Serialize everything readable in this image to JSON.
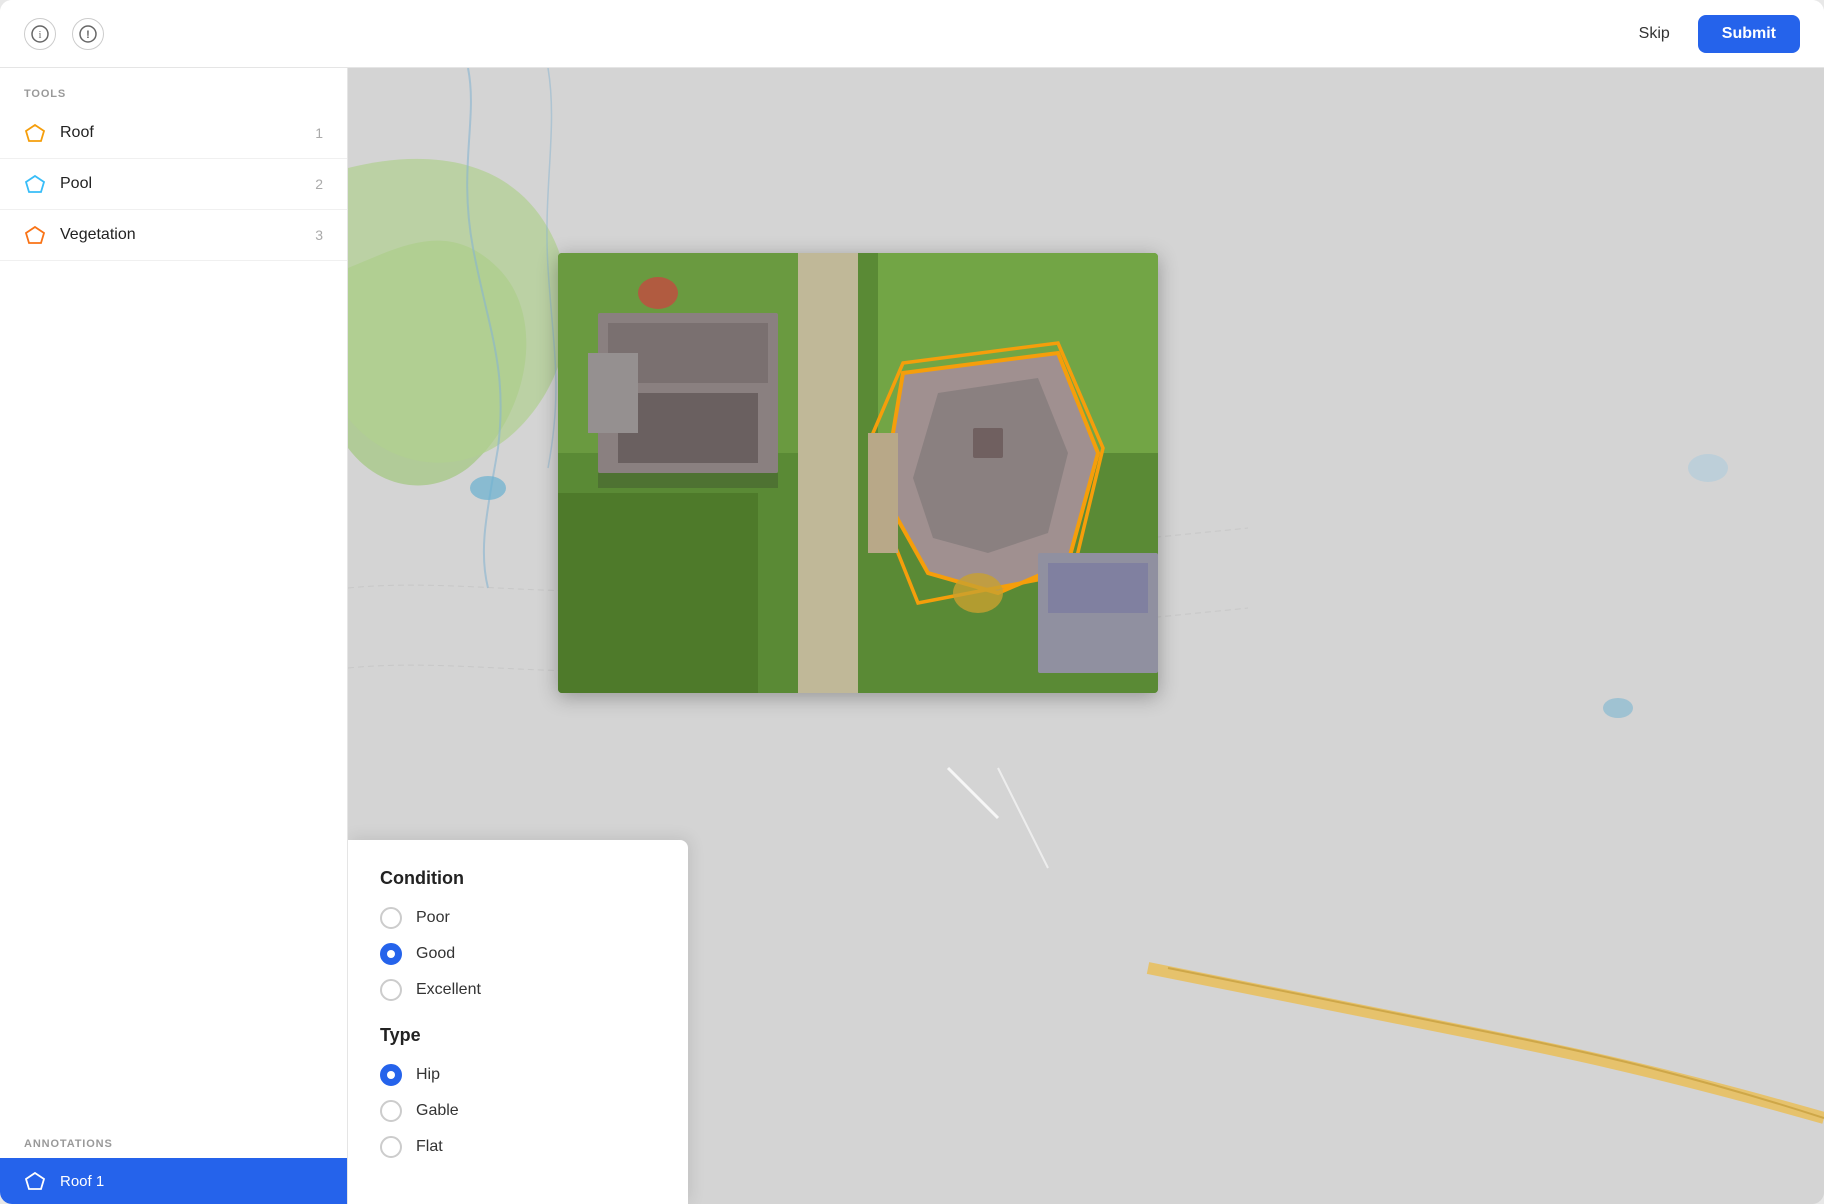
{
  "header": {
    "info_icon": "ℹ",
    "alert_icon": "!",
    "skip_label": "Skip",
    "submit_label": "Submit"
  },
  "sidebar": {
    "tools_label": "TOOLS",
    "tools": [
      {
        "id": "roof",
        "label": "Roof",
        "number": "1",
        "icon_color": "#f59e0b",
        "icon_type": "pentagon"
      },
      {
        "id": "pool",
        "label": "Pool",
        "number": "2",
        "icon_color": "#38bdf8",
        "icon_type": "pentagon"
      },
      {
        "id": "vegetation",
        "label": "Vegetation",
        "number": "3",
        "icon_color": "#f97316",
        "icon_type": "pentagon"
      }
    ],
    "annotations_label": "ANNOTATIONS",
    "annotations": [
      {
        "id": "roof1",
        "label": "Roof 1",
        "icon_color": "#fff",
        "selected": true
      }
    ]
  },
  "popup": {
    "condition_title": "Condition",
    "condition_options": [
      {
        "id": "poor",
        "label": "Poor",
        "selected": false
      },
      {
        "id": "good",
        "label": "Good",
        "selected": true
      },
      {
        "id": "excellent",
        "label": "Excellent",
        "selected": false
      }
    ],
    "type_title": "Type",
    "type_options": [
      {
        "id": "hip",
        "label": "Hip",
        "selected": true
      },
      {
        "id": "gable",
        "label": "Gable",
        "selected": false
      },
      {
        "id": "flat",
        "label": "Flat",
        "selected": false
      }
    ]
  }
}
